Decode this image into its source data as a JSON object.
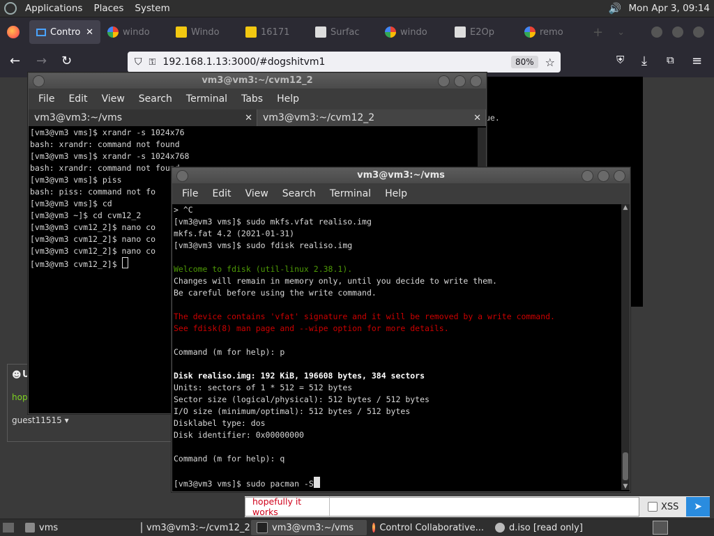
{
  "top_panel": {
    "menus": [
      "Applications",
      "Places",
      "System"
    ],
    "datetime": "Mon Apr  3, 09:14"
  },
  "browser": {
    "tabs": [
      {
        "label": "Contro",
        "active": true,
        "icon": "monitor-icon"
      },
      {
        "label": "windo",
        "active": false,
        "icon": "google-icon"
      },
      {
        "label": "Windo",
        "active": false,
        "icon": "bing-icon"
      },
      {
        "label": "16171",
        "active": false,
        "icon": "bing-icon"
      },
      {
        "label": "Surfac",
        "active": false,
        "icon": "building-icon"
      },
      {
        "label": "windo",
        "active": false,
        "icon": "google-icon"
      },
      {
        "label": "E2Op",
        "active": false,
        "icon": "building-icon"
      },
      {
        "label": "remo",
        "active": false,
        "icon": "google-icon"
      }
    ],
    "url": "192.168.1.13:3000/#dogshitvm1",
    "zoom": "80%"
  },
  "terminal_back": {
    "title": "vm3@vm3:~/cvm12_2",
    "menus": [
      "File",
      "Edit",
      "View",
      "Search",
      "Terminal",
      "Tabs",
      "Help"
    ],
    "tabs": [
      "vm3@vm3:~/vms",
      "vm3@vm3:~/cvm12_2"
    ],
    "lines": [
      "[vm3@vm3 vms]$ xrandr -s 1024x76",
      "bash: xrandr: command not found",
      "[vm3@vm3 vms]$ xrandr -s 1024x768",
      "bash: xrandr: command not found",
      "[vm3@vm3 vms]$ piss",
      "bash: piss: command not fo",
      "[vm3@vm3 vms]$ cd",
      "[vm3@vm3 ~]$ cd cvm12_2",
      "[vm3@vm3 cvm12_2]$ nano co",
      "[vm3@vm3 cvm12_2]$ nano co",
      "[vm3@vm3 cvm12_2]$ nano co",
      "[vm3@vm3 cvm12_2]$ "
    ]
  },
  "terminal_front": {
    "title": "vm3@vm3:~/vms",
    "menus": [
      "File",
      "Edit",
      "View",
      "Search",
      "Terminal",
      "Help"
    ],
    "lines": [
      {
        "text": "> ^C",
        "style": "normal"
      },
      {
        "text": "[vm3@vm3 vms]$ sudo mkfs.vfat realiso.img",
        "style": "normal"
      },
      {
        "text": "mkfs.fat 4.2 (2021-01-31)",
        "style": "normal"
      },
      {
        "text": "[vm3@vm3 vms]$ sudo fdisk realiso.img",
        "style": "normal"
      },
      {
        "text": "",
        "style": "normal"
      },
      {
        "text": "Welcome to fdisk (util-linux 2.38.1).",
        "style": "green"
      },
      {
        "text": "Changes will remain in memory only, until you decide to write them.",
        "style": "normal"
      },
      {
        "text": "Be careful before using the write command.",
        "style": "normal"
      },
      {
        "text": "",
        "style": "normal"
      },
      {
        "text": "The device contains 'vfat' signature and it will be removed by a write command.",
        "style": "red"
      },
      {
        "text": "See fdisk(8) man page and --wipe option for more details.",
        "style": "red"
      },
      {
        "text": "",
        "style": "normal"
      },
      {
        "text": "Command (m for help): p",
        "style": "normal"
      },
      {
        "text": "",
        "style": "normal"
      },
      {
        "text": "Disk realiso.img: 192 KiB, 196608 bytes, 384 sectors",
        "style": "bold"
      },
      {
        "text": "Units: sectors of 1 * 512 = 512 bytes",
        "style": "normal"
      },
      {
        "text": "Sector size (logical/physical): 512 bytes / 512 bytes",
        "style": "normal"
      },
      {
        "text": "I/O size (minimum/optimal): 512 bytes / 512 bytes",
        "style": "normal"
      },
      {
        "text": "Disklabel type: dos",
        "style": "normal"
      },
      {
        "text": "Disk identifier: 0x00000000",
        "style": "normal"
      },
      {
        "text": "",
        "style": "normal"
      },
      {
        "text": "Command (m for help): q",
        "style": "normal"
      },
      {
        "text": "",
        "style": "normal"
      },
      {
        "text": "[vm3@vm3 vms]$ sudo pacman -S",
        "style": "normal"
      }
    ]
  },
  "page": {
    "vm_text": "ue.",
    "user_letter": "U",
    "chat_snippet": "hop",
    "username": "guest11515"
  },
  "chat": {
    "message": "hopefully it works",
    "xss_label": "XSS"
  },
  "taskbar": {
    "items": [
      {
        "label": "vms",
        "icon": "folder-icon"
      },
      {
        "label": "vm3@vm3:~/cvm12_2",
        "icon": "terminal-icon"
      },
      {
        "label": "vm3@vm3:~/vms",
        "icon": "terminal-icon"
      },
      {
        "label": "Control Collaborative...",
        "icon": "firefox-icon"
      },
      {
        "label": "d.iso [read only]",
        "icon": "disk-icon"
      }
    ]
  }
}
